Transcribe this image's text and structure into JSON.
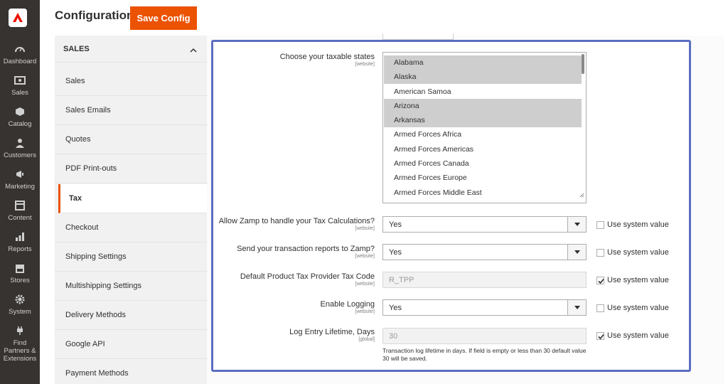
{
  "nav": {
    "items": [
      {
        "name": "dashboard",
        "label": "Dashboard",
        "icon": "gauge-icon"
      },
      {
        "name": "sales",
        "label": "Sales",
        "icon": "dollar-icon"
      },
      {
        "name": "catalog",
        "label": "Catalog",
        "icon": "cube-icon"
      },
      {
        "name": "customers",
        "label": "Customers",
        "icon": "person-icon"
      },
      {
        "name": "marketing",
        "label": "Marketing",
        "icon": "megaphone-icon"
      },
      {
        "name": "content",
        "label": "Content",
        "icon": "layout-icon"
      },
      {
        "name": "reports",
        "label": "Reports",
        "icon": "bar-chart-icon"
      },
      {
        "name": "stores",
        "label": "Stores",
        "icon": "store-icon"
      },
      {
        "name": "system",
        "label": "System",
        "icon": "gear-icon"
      },
      {
        "name": "partners",
        "label": "Find Partners & Extensions",
        "icon": "plug-icon"
      }
    ]
  },
  "header": {
    "title": "Configuration",
    "save_label": "Save Config"
  },
  "sidebar": {
    "section": "SALES",
    "items": [
      {
        "label": "Sales",
        "active": false
      },
      {
        "label": "Sales Emails",
        "active": false
      },
      {
        "label": "Quotes",
        "active": false
      },
      {
        "label": "PDF Print-outs",
        "active": false
      },
      {
        "label": "Tax",
        "active": true
      },
      {
        "label": "Checkout",
        "active": false
      },
      {
        "label": "Shipping Settings",
        "active": false
      },
      {
        "label": "Multishipping Settings",
        "active": false
      },
      {
        "label": "Delivery Methods",
        "active": false
      },
      {
        "label": "Google API",
        "active": false
      },
      {
        "label": "Payment Methods",
        "active": false
      }
    ]
  },
  "form": {
    "states": {
      "label": "Choose your taxable states",
      "scope": "[website]",
      "options": [
        {
          "label": "Alabama",
          "selected": true
        },
        {
          "label": "Alaska",
          "selected": true
        },
        {
          "label": "American Samoa",
          "selected": false
        },
        {
          "label": "Arizona",
          "selected": true
        },
        {
          "label": "Arkansas",
          "selected": true
        },
        {
          "label": "Armed Forces Africa",
          "selected": false
        },
        {
          "label": "Armed Forces Americas",
          "selected": false
        },
        {
          "label": "Armed Forces Canada",
          "selected": false
        },
        {
          "label": "Armed Forces Europe",
          "selected": false
        },
        {
          "label": "Armed Forces Middle East",
          "selected": false
        }
      ]
    },
    "tax_calc": {
      "label": "Allow Zamp to handle your Tax Calculations?",
      "scope": "[website]",
      "value": "Yes",
      "use_system": false
    },
    "reports": {
      "label": "Send your transaction reports to Zamp?",
      "scope": "[website]",
      "value": "Yes",
      "use_system": false
    },
    "tax_code": {
      "label": "Default Product Tax Provider Tax Code",
      "scope": "[website]",
      "value": "R_TPP",
      "use_system": true
    },
    "logging": {
      "label": "Enable Logging",
      "scope": "[website]",
      "value": "Yes",
      "use_system": false
    },
    "lifetime": {
      "label": "Log Entry Lifetime, Days",
      "scope": "[global]",
      "value": "30",
      "use_system": true,
      "note": "Transaction log lifetime in days. If field is empty or less than 30 default value 30 will be saved."
    },
    "use_system_label": "Use system value"
  },
  "colors": {
    "accent": "#eb5202",
    "nav_bg": "#373330",
    "highlight_border": "#5b6dc0"
  }
}
